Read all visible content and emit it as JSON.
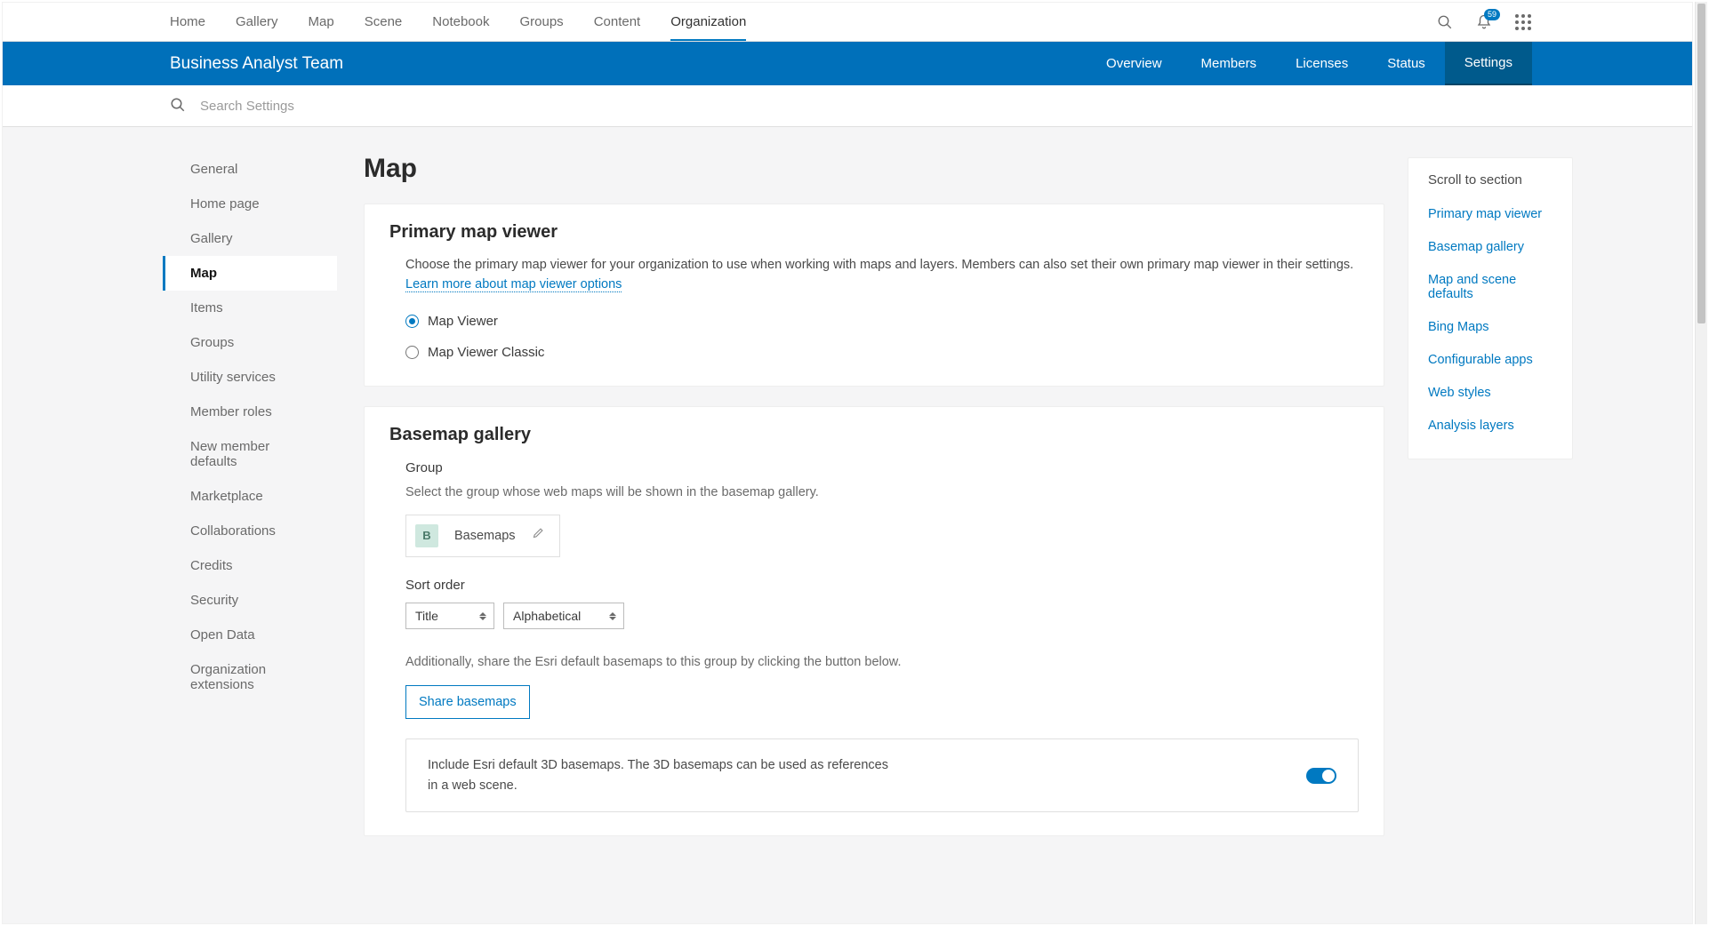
{
  "colors": {
    "accent": "#0079c1",
    "blueBar": "#0070ba",
    "blueBarActive": "#005a8c"
  },
  "topnav": {
    "items": [
      "Home",
      "Gallery",
      "Map",
      "Scene",
      "Notebook",
      "Groups",
      "Content",
      "Organization"
    ],
    "activeIndex": 7,
    "notificationCount": "59"
  },
  "orgbar": {
    "title": "Business Analyst Team",
    "tabs": [
      "Overview",
      "Members",
      "Licenses",
      "Status",
      "Settings"
    ],
    "activeIndex": 4
  },
  "search": {
    "placeholder": "Search Settings"
  },
  "sidebar": {
    "items": [
      "General",
      "Home page",
      "Gallery",
      "Map",
      "Items",
      "Groups",
      "Utility services",
      "Member roles",
      "New member defaults",
      "Marketplace",
      "Collaborations",
      "Credits",
      "Security",
      "Open Data",
      "Organization extensions"
    ],
    "activeIndex": 3
  },
  "page": {
    "title": "Map"
  },
  "primaryViewer": {
    "title": "Primary map viewer",
    "desc": "Choose the primary map viewer for your organization to use when working with maps and layers. Members can also set their own primary map viewer in their settings. ",
    "linkText": "Learn more about map viewer options",
    "options": [
      "Map Viewer",
      "Map Viewer Classic"
    ],
    "selectedIndex": 0
  },
  "basemapGallery": {
    "title": "Basemap gallery",
    "groupLabel": "Group",
    "groupHelp": "Select the group whose web maps will be shown in the basemap gallery.",
    "groupChip": {
      "initial": "B",
      "name": "Basemaps"
    },
    "sortLabel": "Sort order",
    "sortField": "Title",
    "sortDirection": "Alphabetical",
    "shareHelp": "Additionally, share the Esri default basemaps to this group by clicking the button below.",
    "shareButton": "Share basemaps",
    "include3dLabel": "Include Esri default 3D basemaps. The 3D basemaps can be used as references in a web scene.",
    "include3dOn": true
  },
  "toc": {
    "title": "Scroll to section",
    "items": [
      "Primary map viewer",
      "Basemap gallery",
      "Map and scene defaults",
      "Bing Maps",
      "Configurable apps",
      "Web styles",
      "Analysis layers"
    ]
  }
}
